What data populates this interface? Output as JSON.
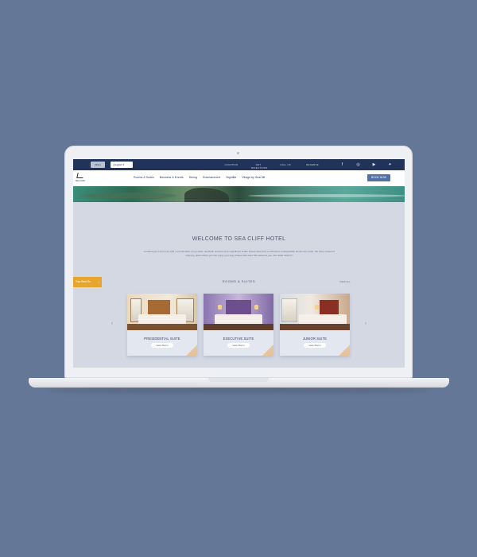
{
  "topbar": {
    "offers_label": "Offers",
    "language_label": "English",
    "links": [
      "LOCATION",
      "GET DIRECTIONS",
      "CALL US",
      "RESERVE"
    ],
    "social_icons": [
      "facebook-icon",
      "tripadvisor-icon",
      "youtube-icon",
      "twitter-icon"
    ]
  },
  "nav": {
    "logo_text": "SEA CLIFF",
    "items": [
      "Rooms & Suites",
      "Business & Events",
      "Dining",
      "Entertainment",
      "Nightlife",
      "Village by SeaCliff"
    ],
    "book_label": "BOOK NOW"
  },
  "welcome": {
    "title": "WELCOME TO SEA CLIFF HOTEL",
    "intro": "Located just in front of a Cliff, a combination of top rated, aesthetic services and magnificent Indian Ocean view form a Cliff where unforgettable stories are made. We have created a stunning place where you can enjoy your stay at Sea Cliff Hotel. We welcome you. We await. ENJOY!"
  },
  "side_tab": {
    "label": "Your Best Go"
  },
  "rooms": {
    "title": "ROOMS & SUITES",
    "view_all": "VIEW ALL",
    "cards": [
      {
        "name": "PRESIDENTIAL SUITE",
        "button": "View Room"
      },
      {
        "name": "EXECUTIVE SUITE",
        "button": "View Room"
      },
      {
        "name": "JUNIOR SUITE",
        "button": "View Room"
      }
    ]
  },
  "colors": {
    "page_bg": "#657796",
    "topbar": "#22335a",
    "accent": "#5570a4",
    "tab": "#e8a52d"
  }
}
